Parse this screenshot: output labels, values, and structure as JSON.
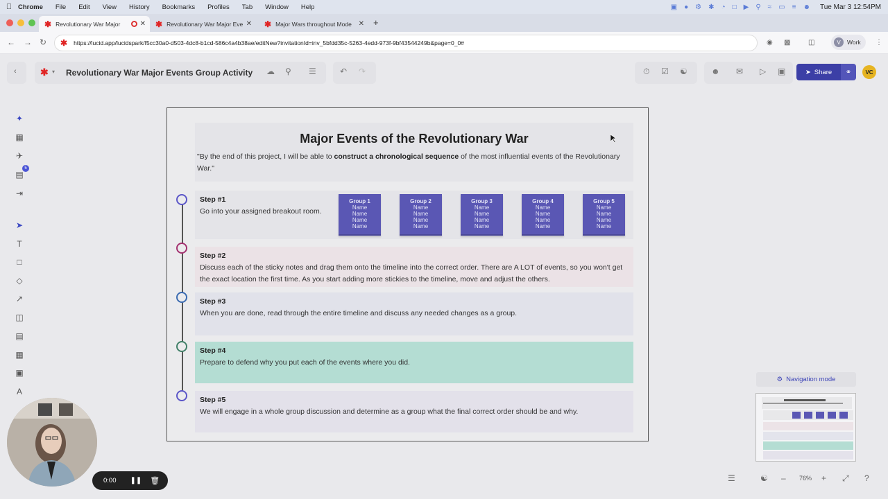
{
  "menubar": {
    "app": "Chrome",
    "items": [
      "File",
      "Edit",
      "View",
      "History",
      "Bookmarks",
      "Profiles",
      "Tab",
      "Window",
      "Help"
    ],
    "clock": "Tue Mar 3  12:54PM"
  },
  "tabs": [
    {
      "title": "Revolutionary War Major",
      "active": true
    },
    {
      "title": "Revolutionary War Major Eve"
    },
    {
      "title": "Major Wars throughout Mode"
    }
  ],
  "address": {
    "url": "https://lucid.app/lucidspark/f5cc30a0-d503-4dc8-b1cd-586c4a4b38ae/editNew?invitationId=inv_5bfdd35c-5263-4edd-973f-9bf43544249b&page=0_0#",
    "profile_initial": "V",
    "profile_label": "Work"
  },
  "app": {
    "doc_title": "Revolutionary War Major Events Group Activity",
    "share_label": "Share",
    "user_initials": "VC",
    "rail_badge": "5"
  },
  "board": {
    "title": "Major Events of the Revolutionary War",
    "quote_start": "\"By the end of this project, I will be able to ",
    "quote_bold": "construct a chronological sequence",
    "quote_end": " of the most influential events of the Revolutionary War.\"",
    "steps": [
      {
        "title": "Step #1",
        "text": "Go into your assigned breakout room."
      },
      {
        "title": "Step #2",
        "text": "Discuss each of the sticky notes and drag them onto the timeline into the correct order.  There are A LOT of events, so you won't get the exact location the first time.  As you start adding more stickies to the timeline, move and adjust the others."
      },
      {
        "title": "Step #3",
        "text": "When you are done, read through the entire timeline and discuss any needed changes as a group."
      },
      {
        "title": "Step #4",
        "text": "Prepare to defend why you put each of the events where you did."
      },
      {
        "title": "Step #5",
        "text": "We will engage in a whole group discussion and determine as a group what the final correct order should be and why."
      }
    ],
    "groups": [
      {
        "label": "Group 1",
        "names": [
          "Name",
          "Name",
          "Name",
          "Name"
        ]
      },
      {
        "label": "Group 2",
        "names": [
          "Name",
          "Name",
          "Name",
          "Name"
        ]
      },
      {
        "label": "Group 3",
        "names": [
          "Name",
          "Name",
          "Name",
          "Name"
        ]
      },
      {
        "label": "Group 4",
        "names": [
          "Name",
          "Name",
          "Name",
          "Name"
        ]
      },
      {
        "label": "Group 5",
        "names": [
          "Name",
          "Name",
          "Name",
          "Name"
        ]
      }
    ],
    "colors": {
      "step1": "#e4e4e8",
      "step2": "#ebe2e6",
      "step3": "#e1e2ea",
      "step4": "#b4ddd3",
      "step5": "#e3e1ea",
      "node1": "#5b56c8",
      "node2": "#a3306f",
      "node3": "#3a6ab0",
      "node4": "#3f7f67",
      "node5": "#5b56c8",
      "sticky": "#5a57b4"
    }
  },
  "navigation": {
    "label": "Navigation mode"
  },
  "zoom": {
    "level": "76%"
  },
  "recorder": {
    "time": "0:00"
  }
}
